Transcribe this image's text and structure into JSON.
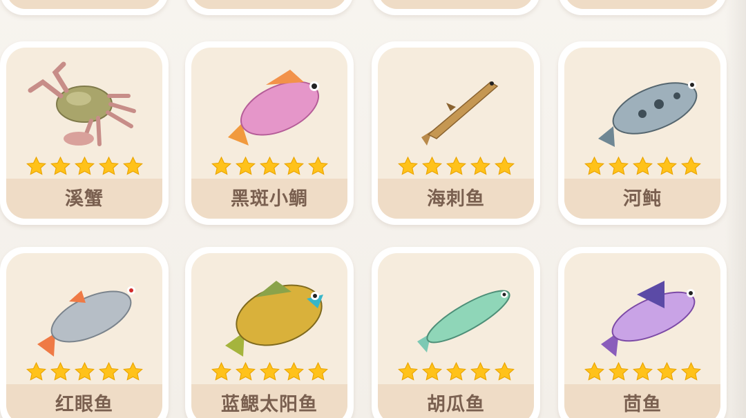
{
  "colors": {
    "star": "#ffc21a",
    "card_bg": "#f6ecdd",
    "name_plate": "#efdcc6",
    "name_text": "#7a6050"
  },
  "rows": [
    {
      "items": [
        {
          "name": "溪蟹",
          "stars": 5,
          "icon": "crab-icon"
        },
        {
          "name": "黑斑小鲷",
          "stars": 5,
          "icon": "pink-bream-icon"
        },
        {
          "name": "海刺鱼",
          "stars": 5,
          "icon": "stickleback-icon"
        },
        {
          "name": "河鲀",
          "stars": 5,
          "icon": "pufferfish-icon"
        }
      ]
    },
    {
      "items": [
        {
          "name": "红眼鱼",
          "stars": 5,
          "icon": "rudd-icon"
        },
        {
          "name": "蓝鳃太阳鱼",
          "stars": 5,
          "icon": "bluegill-icon"
        },
        {
          "name": "胡瓜鱼",
          "stars": 5,
          "icon": "smelt-icon"
        },
        {
          "name": "茴鱼",
          "stars": 5,
          "icon": "grayling-icon"
        }
      ]
    }
  ]
}
